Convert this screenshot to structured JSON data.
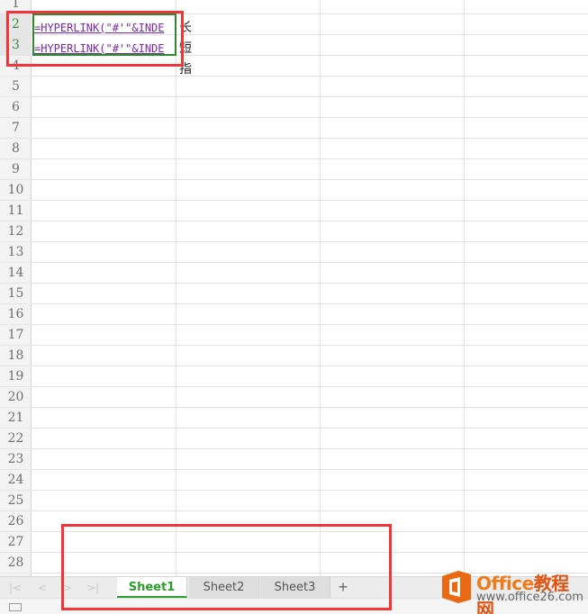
{
  "sheet": {
    "rows": [
      "1",
      "2",
      "3",
      "4",
      "5",
      "6",
      "7",
      "8",
      "9",
      "10",
      "11",
      "12",
      "13",
      "14",
      "15",
      "16",
      "17",
      "18",
      "19",
      "20",
      "21",
      "22",
      "23",
      "24",
      "25",
      "26",
      "27",
      "28"
    ],
    "cells": {
      "a2": "=HYPERLINK(\"#'\"&INDE",
      "a3": "=HYPERLINK(\"#'\"&INDE",
      "b2": "长",
      "b3": "短",
      "b4": "指"
    }
  },
  "tabs": {
    "items": [
      "Sheet1",
      "Sheet2",
      "Sheet3"
    ],
    "active": "Sheet1",
    "add": "+"
  },
  "nav": {
    "first": "|<",
    "prev": "<",
    "next": ">",
    "last": ">|"
  },
  "watermark": {
    "name": "Office",
    "name_cn": "教程网",
    "url": "www.office26.com"
  },
  "colors": {
    "formula": "#7a2aa8",
    "selection": "#2e8a2e",
    "highlight": "#f0363a",
    "active_tab": "#2aa02a"
  }
}
